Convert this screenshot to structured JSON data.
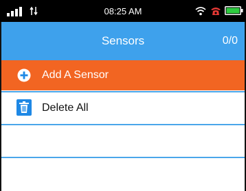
{
  "status_bar": {
    "time": "08:25 AM",
    "icons": [
      "cellular-signal-icon",
      "data-transfer-icon",
      "wifi-icon",
      "alarm-icon",
      "battery-icon"
    ],
    "battery_color": "#2ecc40"
  },
  "header": {
    "title": "Sensors",
    "count": "0/0",
    "color": "#3ea1ec"
  },
  "list": {
    "add_label": "Add A Sensor",
    "add_color": "#f26522",
    "delete_label": "Delete All",
    "delete_icon_color": "#1e88e5"
  }
}
